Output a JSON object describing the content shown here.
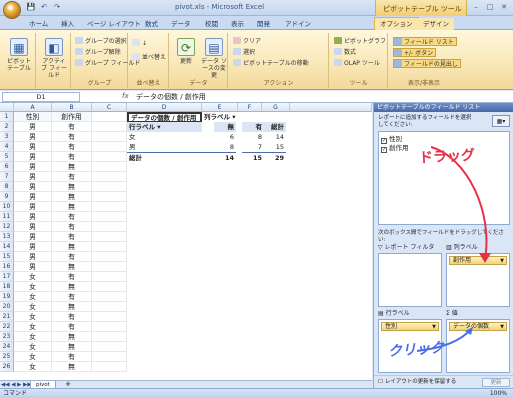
{
  "window": {
    "title": "pivot.xls - Microsoft Excel",
    "context_title": "ピボットテーブル ツール"
  },
  "qat": [
    "💾",
    "↶",
    "↷"
  ],
  "tabs": [
    {
      "label": "ホーム"
    },
    {
      "label": "挿入"
    },
    {
      "label": "ページ レイアウト"
    },
    {
      "label": "数式"
    },
    {
      "label": "データ"
    },
    {
      "label": "校閲"
    },
    {
      "label": "表示"
    },
    {
      "label": "開発"
    },
    {
      "label": "アドイン"
    },
    {
      "label": "オプション",
      "active": true,
      "ctx": true
    },
    {
      "label": "デザイン",
      "ctx": true
    }
  ],
  "ribbon": {
    "groups": [
      {
        "label": "",
        "buttons": [
          {
            "label": "ピボットテーブル"
          }
        ]
      },
      {
        "label": "",
        "buttons": [
          {
            "label": "アクティブ フィールド"
          }
        ]
      },
      {
        "label": "グループ",
        "items": [
          "グループの選択",
          "グループ解除",
          "グループ フィールド"
        ]
      },
      {
        "label": "並べ替え",
        "items": [
          "",
          "並べ替え"
        ]
      },
      {
        "label": "データ",
        "buttons": [
          {
            "label": "更新"
          },
          {
            "label": "データ ソースの変更"
          }
        ]
      },
      {
        "label": "アクション",
        "items": [
          "クリア",
          "選択",
          "ピボットテーブルの移動"
        ]
      },
      {
        "label": "ツール",
        "items": [
          "ピボットグラフ",
          "数式",
          "OLAP ツール"
        ]
      },
      {
        "label": "表示/非表示",
        "items": [
          "フィールド リスト",
          "+/- ボタン",
          "フィールドの見出し"
        ]
      }
    ]
  },
  "formula_bar": {
    "name_box": "D1",
    "fx": "fx",
    "formula": "データの個数 / 創作用"
  },
  "columns": [
    "A",
    "B",
    "C",
    "D",
    "E",
    "F",
    "G"
  ],
  "rows": [
    {
      "n": "1",
      "a": "性別",
      "b": "創作用"
    },
    {
      "n": "2",
      "a": "男",
      "b": "有"
    },
    {
      "n": "3",
      "a": "男",
      "b": "有"
    },
    {
      "n": "4",
      "a": "男",
      "b": "有"
    },
    {
      "n": "5",
      "a": "男",
      "b": "有"
    },
    {
      "n": "6",
      "a": "男",
      "b": "無"
    },
    {
      "n": "7",
      "a": "男",
      "b": "有"
    },
    {
      "n": "8",
      "a": "男",
      "b": "無"
    },
    {
      "n": "9",
      "a": "男",
      "b": "無"
    },
    {
      "n": "10",
      "a": "男",
      "b": "無"
    },
    {
      "n": "11",
      "a": "男",
      "b": "有"
    },
    {
      "n": "12",
      "a": "男",
      "b": "有"
    },
    {
      "n": "13",
      "a": "男",
      "b": "有"
    },
    {
      "n": "14",
      "a": "男",
      "b": "無"
    },
    {
      "n": "15",
      "a": "男",
      "b": "有"
    },
    {
      "n": "16",
      "a": "男",
      "b": "無"
    },
    {
      "n": "17",
      "a": "女",
      "b": "有"
    },
    {
      "n": "18",
      "a": "女",
      "b": "無"
    },
    {
      "n": "19",
      "a": "女",
      "b": "有"
    },
    {
      "n": "20",
      "a": "女",
      "b": "無"
    },
    {
      "n": "21",
      "a": "女",
      "b": "有"
    },
    {
      "n": "22",
      "a": "女",
      "b": "有"
    },
    {
      "n": "23",
      "a": "女",
      "b": "無"
    },
    {
      "n": "24",
      "a": "女",
      "b": "無"
    },
    {
      "n": "25",
      "a": "女",
      "b": "有"
    },
    {
      "n": "26",
      "a": "女",
      "b": "無"
    }
  ],
  "pivot": {
    "header": "データの個数 / 創作用",
    "col_label": "列ラベル",
    "row_label": "行ラベル",
    "col_values": [
      "無",
      "有",
      "総計"
    ],
    "rows": [
      {
        "label": "女",
        "values": [
          "6",
          "8",
          "14"
        ]
      },
      {
        "label": "男",
        "values": [
          "8",
          "7",
          "15"
        ]
      }
    ],
    "total": {
      "label": "総計",
      "values": [
        "14",
        "15",
        "29"
      ]
    }
  },
  "sheet_tabs": {
    "nav": "◀◀ ◀ ▶ ▶▶",
    "active": "pivot"
  },
  "status": {
    "left": "コマンド",
    "zoom": "100%"
  },
  "pane": {
    "title": "ピボットテーブルのフィールド リスト",
    "instruction": "レポートに追加するフィールドを選択してください:",
    "fields": [
      {
        "label": "性別",
        "checked": true
      },
      {
        "label": "創作用",
        "checked": true
      }
    ],
    "areas_instruction": "次のボックス間でフィールドをドラッグしてください:",
    "areas": {
      "report_filter": {
        "label": "レポート フィルタ",
        "items": []
      },
      "col_labels": {
        "label": "列ラベル",
        "items": [
          "創作用"
        ]
      },
      "row_labels": {
        "label": "行ラベル",
        "items": [
          "性別"
        ]
      },
      "values": {
        "label": "値",
        "items": [
          "データの個数"
        ]
      }
    },
    "defer": "レイアウトの更新を保留する",
    "update": "更新"
  },
  "annotations": {
    "drag": "ドラッグ",
    "click": "クリック"
  },
  "colors": {
    "annotation_red": "#e8304a",
    "annotation_blue": "#4a6de8"
  }
}
